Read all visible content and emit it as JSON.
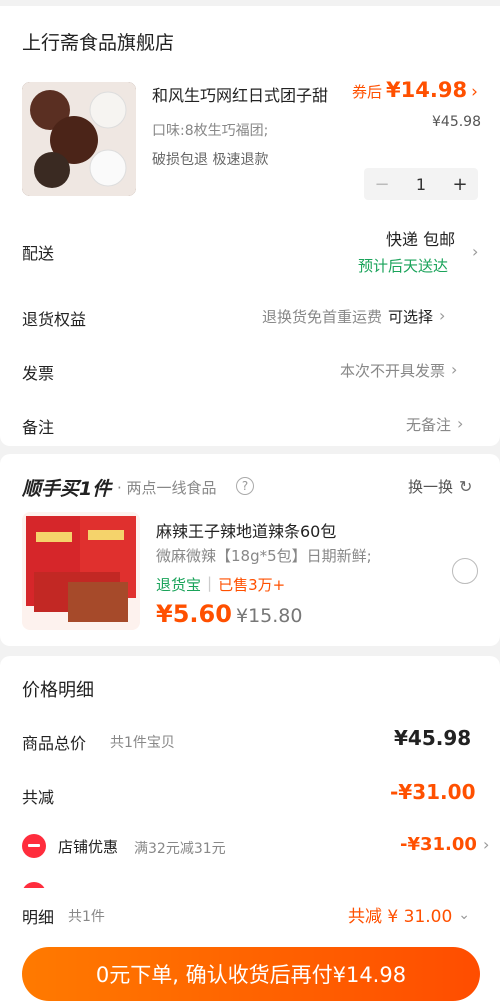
{
  "store": {
    "name": "上行斋食品旗舰店",
    "product": {
      "title": "和风生巧网红日式团子甜",
      "coupon_price_label": "券后",
      "coupon_price": "¥14.98",
      "original_price": "¥45.98",
      "flavor": "口味:8枚生巧福团;",
      "service": "破损包退 极速退款",
      "qty_minus": "−",
      "qty": "1",
      "qty_plus": "+"
    }
  },
  "delivery": {
    "label": "配送",
    "method": "快递 包邮",
    "eta": "预计后天送达"
  },
  "returns": {
    "label": "退货权益",
    "desc": "退换货免首重运费",
    "action": "可选择"
  },
  "invoice": {
    "label": "发票",
    "value": "本次不开具发票"
  },
  "remark": {
    "label": "备注",
    "value": "无备注"
  },
  "addon": {
    "brand": "顺手买1件",
    "subtitle": "· 两点一线食品",
    "help_icon": "?",
    "swap_label": "换一换",
    "item": {
      "title": "麻辣王子辣地道辣条60包",
      "desc": "微麻微辣【18g*5包】日期新鲜;",
      "badge": "退货宝",
      "sold": "已售3万+",
      "price": "¥5.60",
      "orig_price": "¥15.80"
    }
  },
  "price_detail": {
    "title": "价格明细",
    "total_label": "商品总价",
    "total_sub": "共1件宝贝",
    "total_value": "¥45.98",
    "reduce_label": "共减",
    "reduce_value": "-¥31.00",
    "shop_label": "店铺优惠",
    "shop_sub": "满32元减31元",
    "shop_value": "-¥31.00"
  },
  "footer": {
    "detail_label": "明细",
    "detail_sub": "共1件",
    "saved": "共减 ¥ 31.00",
    "button": "0元下单, 确认收货后再付¥14.98"
  },
  "colors": {
    "accent": "#ff5000",
    "green": "#1aa35a"
  }
}
